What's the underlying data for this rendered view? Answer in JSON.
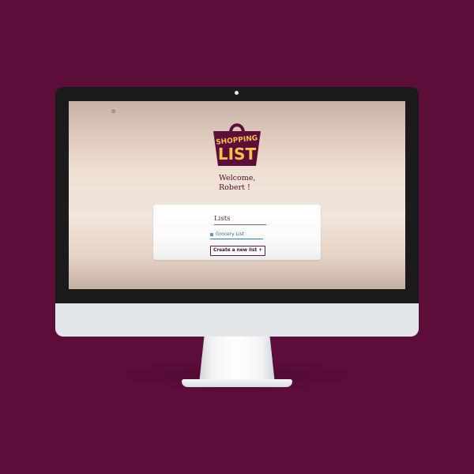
{
  "app": {
    "menu_icon": "hamburger-menu-icon",
    "logo": {
      "line1": "SHOPPING",
      "line2": "LIST",
      "bag_color": "#5c0d3a",
      "text_color": "#f5c24a"
    },
    "welcome": {
      "line1": "Welcome,",
      "line2": "Robert !"
    },
    "note": "",
    "lists_panel": {
      "title": "Lists",
      "items": [
        {
          "label": "Grocery List",
          "icon": "list-bullet-icon"
        }
      ],
      "create_button_label": "Create a new list +"
    }
  },
  "colors": {
    "background": "#5c0d3a",
    "accent": "#5c0d3a",
    "link": "#2d6fa0"
  }
}
